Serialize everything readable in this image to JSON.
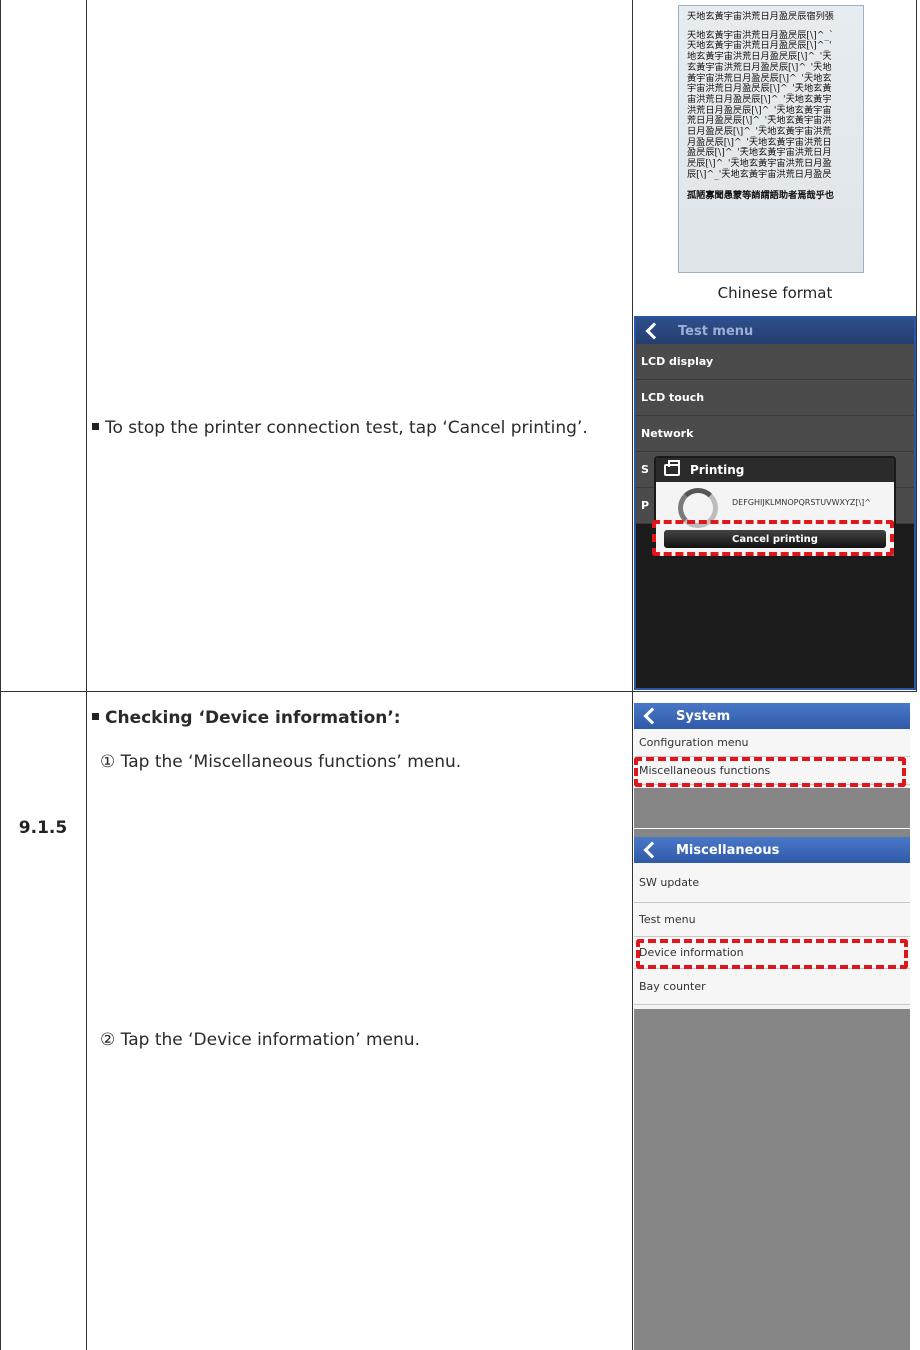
{
  "top_row": {
    "caption": "Chinese format",
    "instruction": "To stop the printer connection test, tap ‘Cancel printing’."
  },
  "chinese_sample": {
    "header": "天地玄黃宇宙洪荒日月盈昃辰宿列張",
    "lines": [
      "天地玄黃宇宙洪荒日月盈昃辰[\\]^_`",
      "天地玄黃宇宙洪荒日月盈昃辰[\\]^_'",
      "地玄黃宇宙洪荒日月盈昃辰[\\]^_'天",
      "玄黃宇宙洪荒日月盈昃辰[\\]^_'天地",
      "黃宇宙洪荒日月盈昃辰[\\]^_'天地玄",
      "宇宙洪荒日月盈昃辰[\\]^_'天地玄黃",
      "宙洪荒日月盈昃辰[\\]^_'天地玄黃宇",
      "洪荒日月盈昃辰[\\]^_'天地玄黃宇宙",
      "荒日月盈昃辰[\\]^_'天地玄黃宇宙洪",
      "日月盈昃辰[\\]^_'天地玄黃宇宙洪荒",
      "月盈昃辰[\\]^_'天地玄黃宇宙洪荒日",
      "盈昃辰[\\]^_'天地玄黃宇宙洪荒日月",
      "昃辰[\\]^_'天地玄黃宇宙洪荒日月盈",
      "辰[\\]^_'天地玄黃宇宙洪荒日月盈昃"
    ],
    "footer": "孤陋寡聞愚蒙等誚謂語助者焉哉乎也"
  },
  "test_menu_screen": {
    "title": "Test menu",
    "items": [
      "LCD display",
      "LCD touch",
      "Network",
      "S",
      "P"
    ],
    "dialog_title": "Printing",
    "dialog_text": "DEFGHIJKLMNOPQRSTUVWXYZ[\\]^",
    "cancel_label": "Cancel printing"
  },
  "section": {
    "number": "9.1.5",
    "heading": "Checking ‘Device information’:",
    "step1": "① Tap the ‘Miscellaneous functions’ menu.",
    "step2": "② Tap the ‘Device information’ menu."
  },
  "system_screen": {
    "title": "System",
    "items": [
      "Configuration menu",
      "Miscellaneous functions"
    ]
  },
  "misc_screen": {
    "title": "Miscellaneous",
    "items": [
      "SW update",
      "Test menu",
      "Device information",
      "Bay counter"
    ]
  },
  "colors": {
    "highlight": "#e0161b",
    "titlebar": "#3a66b8"
  }
}
